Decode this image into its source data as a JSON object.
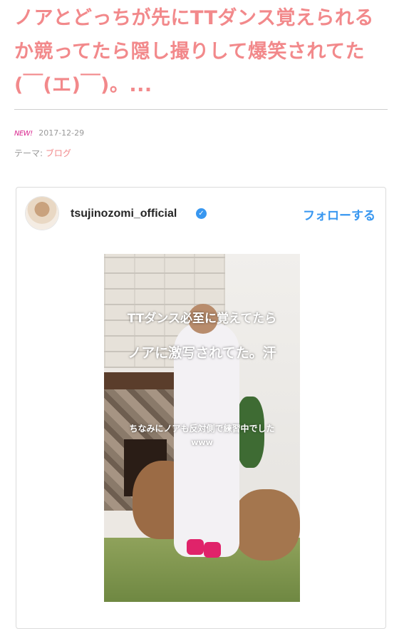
{
  "article": {
    "title": "ノアとどっちが先にTTダンス覚えられるか競ってたら隠し撮りして爆笑されてた(￣(エ)￣)。...",
    "new_badge": "NEW!",
    "date": "2017-12-29",
    "theme_label": "テーマ:",
    "theme_value": "ブログ"
  },
  "embed": {
    "username": "tsujinozomi_official",
    "verified_mark": "✓",
    "follow_label": "フォローする",
    "media": {
      "caption_line1": "TTダンス必至に覚えてたら",
      "caption_line2": "ノアに激写されてた。汗",
      "caption_line3": "ちなみにノアも反対側で練習中でした",
      "caption_line4": "www"
    }
  },
  "colors": {
    "title": "#f2898b",
    "new_badge": "#d9288f",
    "link_blue": "#3897f0",
    "divider": "#cfcfcf"
  },
  "icons": {
    "verified": "verified-badge-icon",
    "avatar": "profile-avatar"
  }
}
